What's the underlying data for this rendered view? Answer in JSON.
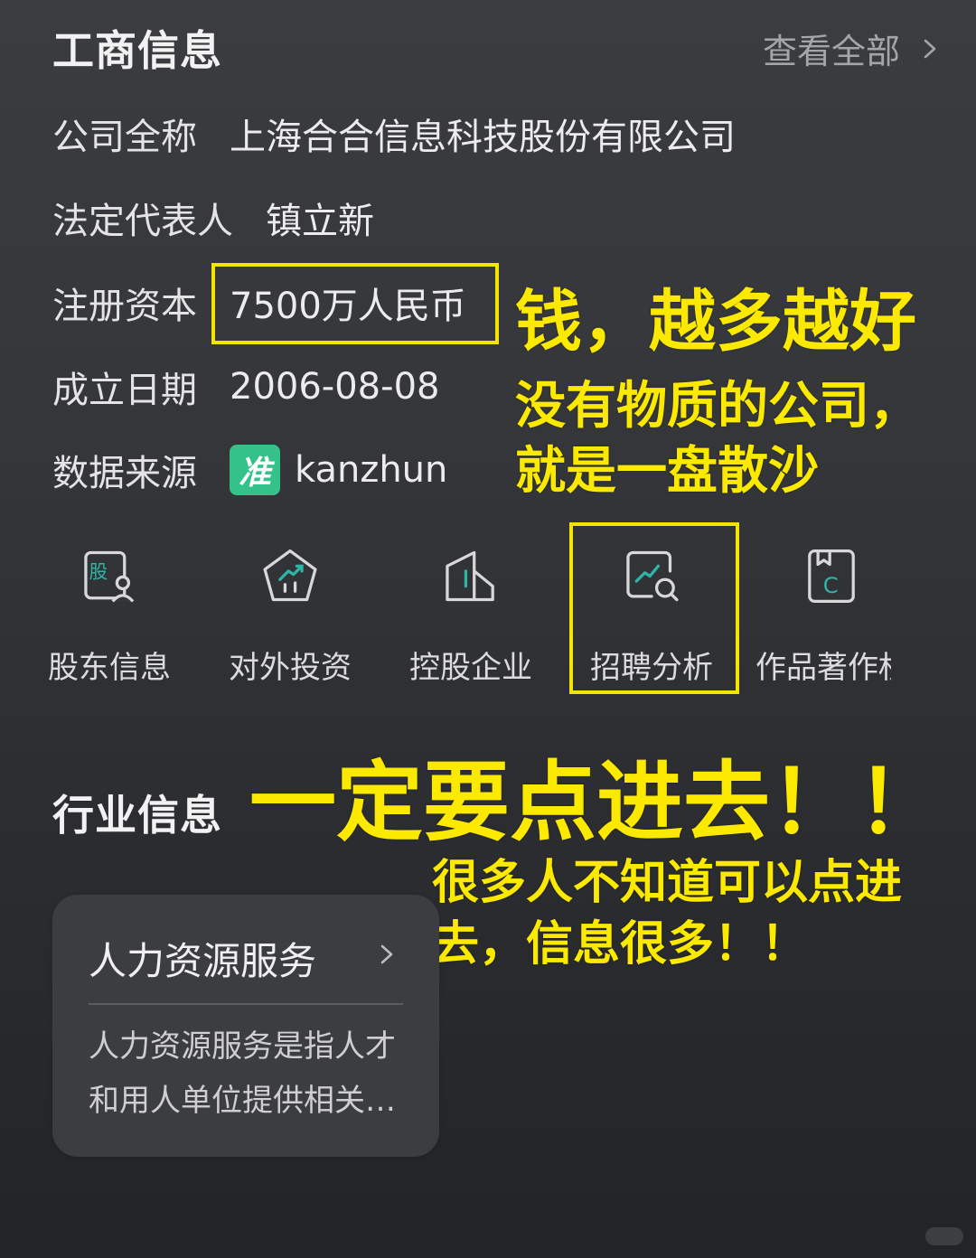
{
  "header": {
    "title": "工商信息",
    "view_all": "查看全部"
  },
  "info": {
    "company_name_label": "公司全称",
    "company_name_value": "上海合合信息科技股份有限公司",
    "legal_rep_label": "法定代表人",
    "legal_rep_value": "镇立新",
    "capital_label": "注册资本",
    "capital_value": "7500万人民币",
    "founded_label": "成立日期",
    "founded_value": "2006-08-08",
    "source_label": "数据来源",
    "source_logo_char": "准",
    "source_value": "kanzhun"
  },
  "tools": [
    {
      "label": "股东信息",
      "icon": "shareholder-icon",
      "glyph": "股"
    },
    {
      "label": "对外投资",
      "icon": "investment-icon"
    },
    {
      "label": "控股企业",
      "icon": "holding-company-icon"
    },
    {
      "label": "招聘分析",
      "icon": "recruitment-analysis-icon"
    },
    {
      "label": "作品著作权",
      "icon": "copyright-icon",
      "glyph": "C"
    }
  ],
  "industry": {
    "title": "行业信息",
    "card": {
      "title": "人力资源服务",
      "desc_line1": "人力资源服务是指人才",
      "desc_line2": "和用人单位提供相关…"
    }
  },
  "annotations": {
    "money": "钱，越多越好",
    "material_line1": "没有物质的公司，",
    "material_line2": "就是一盘散沙",
    "click_in": "一定要点进去！！",
    "many_line1": "很多人不知道可以点进",
    "many_line2": "去，信息很多！！"
  },
  "colors": {
    "background": "#34363a",
    "highlight": "#f4e500",
    "accent_teal": "#35c28a",
    "icon_teal": "#2fb5a8"
  }
}
